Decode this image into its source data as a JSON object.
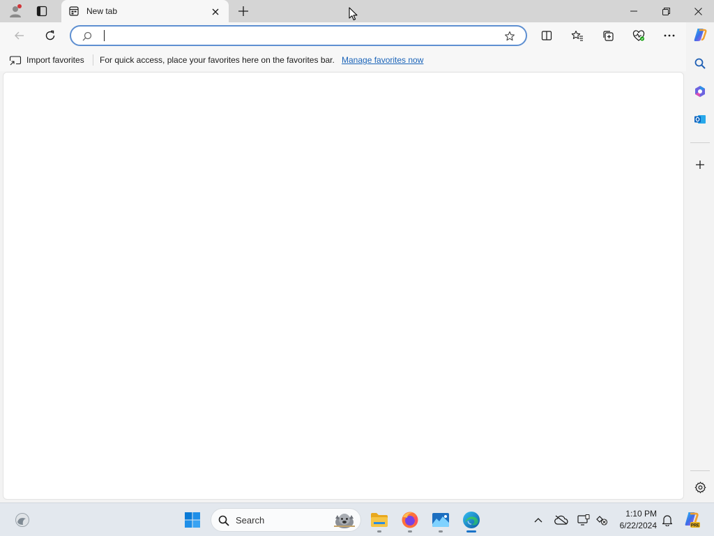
{
  "browser": {
    "tab": {
      "title": "New tab"
    },
    "address_bar": {
      "value": "",
      "placeholder": ""
    }
  },
  "favorites_bar": {
    "import_label": "Import favorites",
    "message": "For quick access, place your favorites here on the favorites bar.",
    "manage_link": "Manage favorites now"
  },
  "taskbar": {
    "search_label": "Search",
    "time": "1:10 PM",
    "date": "6/22/2024"
  },
  "colors": {
    "accent": "#1a63b8",
    "edge_blue": "#0c7bd6",
    "windows_blue": "#0078d4"
  },
  "icons": {
    "titlebar": [
      "profile-icon",
      "workspaces-icon",
      "tab-page-icon",
      "tab-close-icon",
      "new-tab-icon",
      "minimize-icon",
      "restore-icon",
      "close-window-icon"
    ],
    "toolbar": [
      "back-icon",
      "refresh-icon",
      "search-icon",
      "favorite-star-icon",
      "split-screen-icon",
      "favorites-icon",
      "collections-icon",
      "browser-essentials-icon",
      "more-icon",
      "copilot-icon"
    ],
    "sidebar": [
      "sidebar-search-icon",
      "office-icon",
      "outlook-icon",
      "add-icon",
      "settings-icon"
    ],
    "taskbar": [
      "widgets-icon",
      "start-icon",
      "taskbar-search-icon",
      "file-explorer-icon",
      "firefox-icon",
      "photos-icon",
      "edge-icon",
      "tray-chevron-icon",
      "onedrive-icon",
      "display-icon",
      "network-icon",
      "notifications-icon",
      "copilot-pre-icon"
    ]
  }
}
